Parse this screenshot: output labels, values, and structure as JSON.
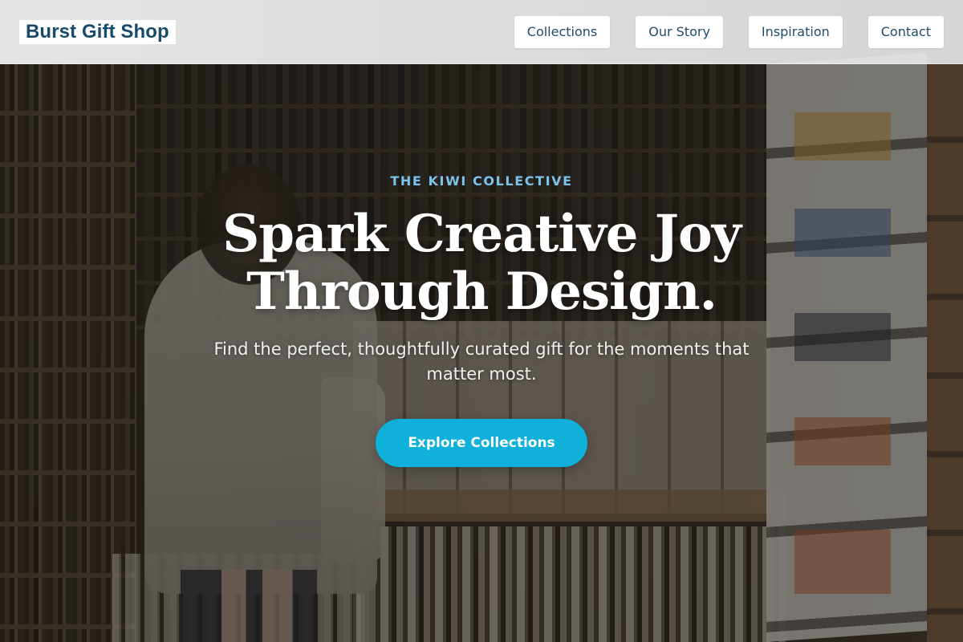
{
  "header": {
    "brand": "Burst Gift Shop",
    "nav": [
      {
        "label": "Collections"
      },
      {
        "label": "Our Story"
      },
      {
        "label": "Inspiration"
      },
      {
        "label": "Contact"
      }
    ]
  },
  "hero": {
    "eyebrow": "THE KIWI COLLECTIVE",
    "headline": "Spark Creative Joy Through Design.",
    "subtext": "Find the perfect, thoughtfully curated gift for the moments that matter most.",
    "cta_label": "Explore Collections",
    "background_image": "shop-interior-photo"
  },
  "colors": {
    "brand_text": "#174a6b",
    "eyebrow": "#7cc3ec",
    "cta_background": "#0fb0d9",
    "nav_text": "#1f4d6a"
  }
}
